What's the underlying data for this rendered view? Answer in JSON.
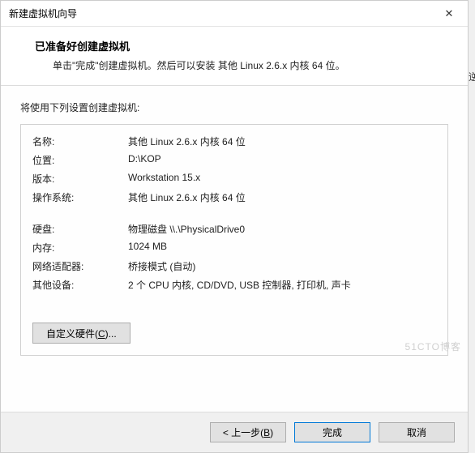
{
  "window": {
    "title": "新建虚拟机向导",
    "close_icon": "✕"
  },
  "header": {
    "title": "已准备好创建虚拟机",
    "desc": "单击\"完成\"创建虚拟机。然后可以安装 其他 Linux 2.6.x 内核 64 位。"
  },
  "body": {
    "intro": "将使用下列设置创建虚拟机:",
    "rows": [
      {
        "label": "名称:",
        "value": "其他 Linux 2.6.x 内核 64 位"
      },
      {
        "label": "位置:",
        "value": "D:\\KOP"
      },
      {
        "label": "版本:",
        "value": "Workstation 15.x"
      },
      {
        "label": "操作系统:",
        "value": "其他 Linux 2.6.x 内核 64 位"
      },
      {
        "label": "",
        "value": ""
      },
      {
        "label": "硬盘:",
        "value": "物理磁盘 \\\\.\\PhysicalDrive0"
      },
      {
        "label": "内存:",
        "value": "1024 MB"
      },
      {
        "label": "网络适配器:",
        "value": "桥接模式 (自动)"
      },
      {
        "label": "其他设备:",
        "value": "2 个 CPU 内核, CD/DVD, USB 控制器, 打印机, 声卡"
      }
    ],
    "customize_prefix": "自定义硬件(",
    "customize_key": "C",
    "customize_suffix": ")..."
  },
  "footer": {
    "back_prefix": "< 上一步(",
    "back_key": "B",
    "back_suffix": ")",
    "finish": "完成",
    "cancel": "取消"
  },
  "side_text": "逆",
  "watermark": "51CTO博客"
}
